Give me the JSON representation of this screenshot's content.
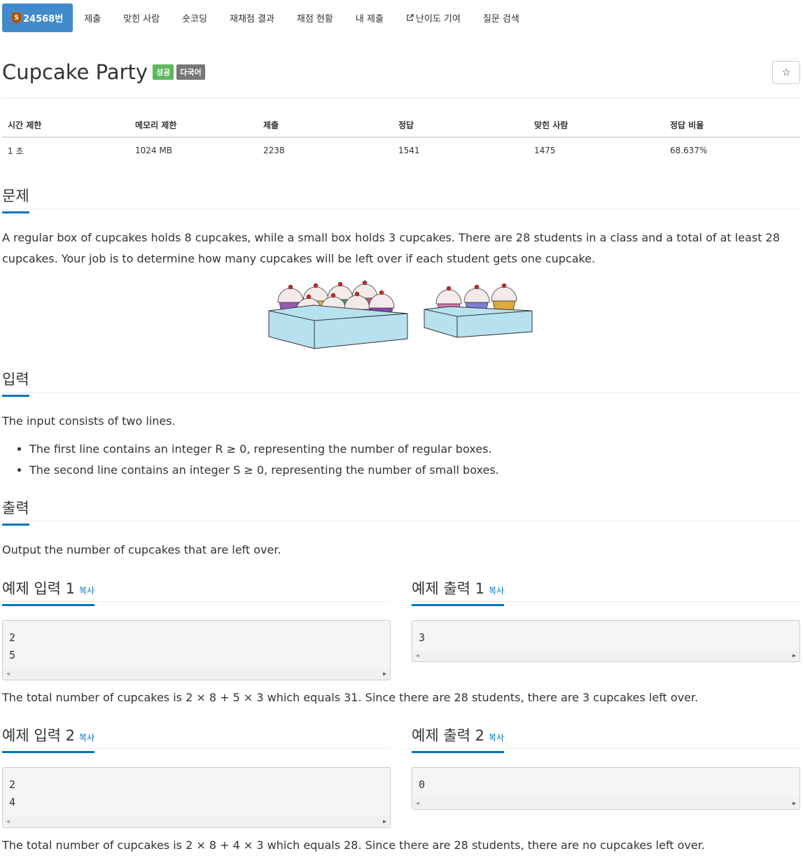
{
  "nav": {
    "problem_tab": "24568번",
    "tier": "5",
    "tabs": [
      "제출",
      "맞힌 사람",
      "숏코딩",
      "재채점 결과",
      "채점 현황",
      "내 제출",
      "난이도 기여",
      "질문 검색"
    ]
  },
  "problem": {
    "title": "Cupcake Party",
    "badge_success": "성공",
    "badge_multilang": "다국어",
    "star": "☆"
  },
  "info": {
    "headers": [
      "시간 제한",
      "메모리 제한",
      "제출",
      "정답",
      "맞힌 사람",
      "정답 비율"
    ],
    "values": [
      "1 초",
      "1024 MB",
      "2238",
      "1541",
      "1475",
      "68.637%"
    ]
  },
  "sections": {
    "description_title": "문제",
    "description": "A regular box of cupcakes holds 8 cupcakes, while a small box holds 3 cupcakes. There are 28 students in a class and a total of at least 28 cupcakes. Your job is to determine how many cupcakes will be left over if each student gets one cupcake.",
    "input_title": "입력",
    "input_intro": "The input consists of two lines.",
    "input_items": [
      "The first line contains an integer R ≥ 0, representing the number of regular boxes.",
      "The second line contains an integer S ≥ 0, representing the number of small boxes."
    ],
    "output_title": "출력",
    "output_text": "Output the number of cupcakes that are left over."
  },
  "samples": [
    {
      "input_title": "예제 입력 1",
      "output_title": "예제 출력 1",
      "copy": "복사",
      "input_lines": [
        "2",
        "5"
      ],
      "output_lines": [
        "3"
      ],
      "explanation": "The total number of cupcakes is 2 × 8 + 5 × 3 which equals 31. Since there are 28 students, there are 3 cupcakes left over."
    },
    {
      "input_title": "예제 입력 2",
      "output_title": "예제 출력 2",
      "copy": "복사",
      "input_lines": [
        "2",
        "4"
      ],
      "output_lines": [
        "0"
      ],
      "explanation": "The total number of cupcakes is 2 × 8 + 4 × 3 which equals 28. Since there are 28 students, there are no cupcakes left over."
    }
  ],
  "colors": {
    "active_tab": "#428bca",
    "tier_bronze": "#ad5600",
    "success": "#5cb85c",
    "multilang": "#777777",
    "accent": "#0076c0",
    "box": "#b7e1ef"
  }
}
